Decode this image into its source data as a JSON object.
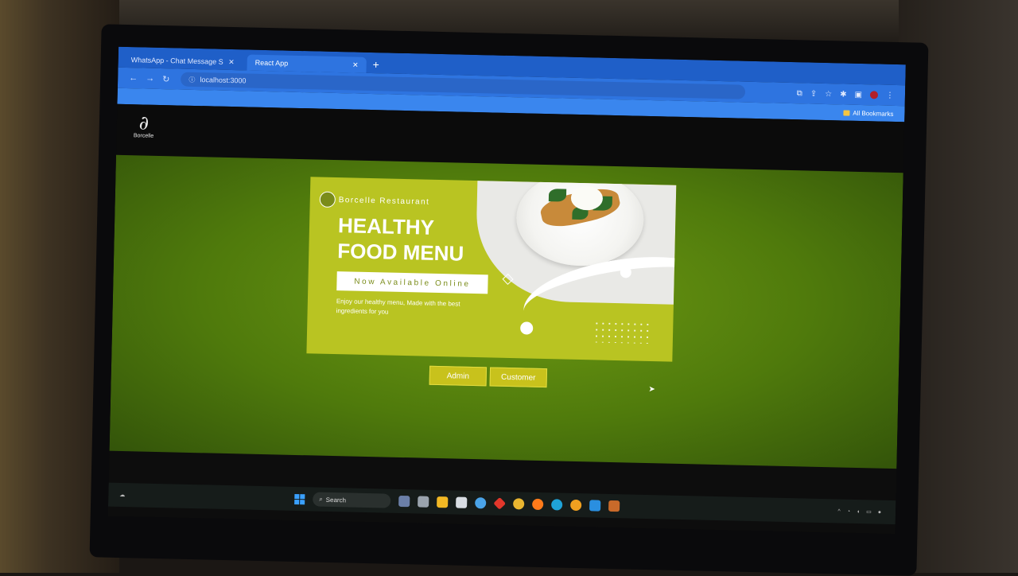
{
  "browser": {
    "tabs": [
      {
        "title": "WhatsApp - Chat Message Sent",
        "active": false
      },
      {
        "title": "React App",
        "active": true
      }
    ],
    "address": "localhost:3000",
    "bookmarks_label": "All Bookmarks"
  },
  "app": {
    "logo_text": "Borcelle",
    "banner": {
      "brand": "Borcelle Restaurant",
      "headline_line1": "HEALTHY",
      "headline_line2": "FOOD MENU",
      "badge": "Now Available Online",
      "tagline": "Enjoy our healthy menu, Made with the best ingredients for you"
    },
    "buttons": {
      "admin": "Admin",
      "customer": "Customer"
    }
  },
  "taskbar": {
    "search_label": "Search"
  }
}
